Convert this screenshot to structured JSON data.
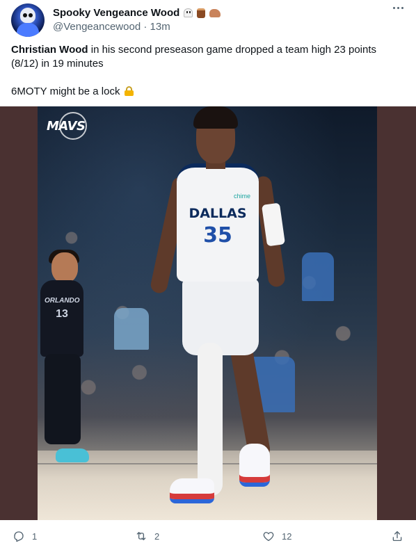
{
  "author": {
    "display_name": "Spooky Vengeance Wood",
    "handle": "@Vengeancewood",
    "time_ago": "13m",
    "name_emojis": [
      "ghost-emoji",
      "wood-emoji",
      "flexed-biceps-emoji"
    ]
  },
  "tweet": {
    "bold_name": "Christian Wood",
    "text_part1": " in his second preseason game dropped a team high 23 points (8/12) in 19 minutes",
    "text_part2": "6MOTY might be a lock",
    "trailing_emoji": "lock-emoji"
  },
  "media": {
    "logo_text": "MAVS",
    "main_jersey_team": "DALLAS",
    "main_jersey_number": "35",
    "sponsor_patch": "chime",
    "bg_jersey_team": "ORLANDO",
    "bg_jersey_number": "13",
    "letterbox_color": "#4a3131"
  },
  "actions": {
    "reply_count": "1",
    "retweet_count": "2",
    "like_count": "12"
  },
  "colors": {
    "text_primary": "#0f1419",
    "text_secondary": "#536471"
  }
}
